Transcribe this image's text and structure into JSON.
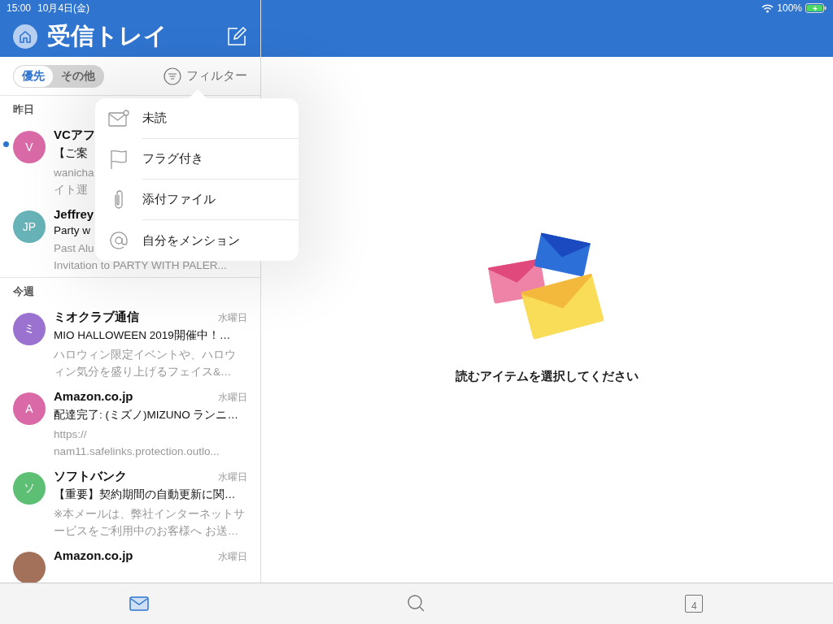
{
  "status_bar": {
    "time": "15:00",
    "date": "10月4日(金)",
    "battery": "100%"
  },
  "header": {
    "title": "受信トレイ"
  },
  "segments": [
    {
      "label": "優先",
      "selected": true
    },
    {
      "label": "その他",
      "selected": false
    }
  ],
  "filter": {
    "label": "フィルター"
  },
  "sections": [
    {
      "heading": "昨日",
      "messages": [
        {
          "initial": "V",
          "color": "#d96aa7",
          "sender": "VCアフ",
          "subject": "【ご案",
          "preview": [
            "wanicha",
            "イト運"
          ],
          "unread": true
        },
        {
          "initial": "JP",
          "color": "#67b3b8",
          "sender": "Jeffrey",
          "subject": "Party w",
          "preview": [
            "Past Alu",
            "Invitation to PARTY WITH PALER..."
          ],
          "unread": false
        }
      ]
    },
    {
      "heading": "今週",
      "messages": [
        {
          "initial": "ミ",
          "color": "#9b72d0",
          "sender": "ミオクラブ通信",
          "date": "水曜日",
          "subject": "MIO HALLOWEEN 2019開催中！…",
          "preview": "ハロウィン限定イベントや、ハロウィン気分を盛り上げるフェイス&…",
          "unread": false
        },
        {
          "initial": "A",
          "color": "#d96aa7",
          "sender": "Amazon.co.jp",
          "date": "水曜日",
          "subject": "配達完了: (ミズノ)MIZUNO ランニ…",
          "preview": "https://\nnam11.safelinks.protection.outlo...",
          "unread": false
        },
        {
          "initial": "ソ",
          "color": "#5cbf74",
          "sender": "ソフトバンク",
          "date": "水曜日",
          "subject": "【重要】契約期間の自動更新に関…",
          "preview": "※本メールは、弊社インターネットサービスをご利用中のお客様へ お送…",
          "unread": false
        },
        {
          "color": "#a3705a",
          "sender": "Amazon.co.jp",
          "date": "水曜日",
          "unread": false
        }
      ]
    }
  ],
  "filter_menu": [
    {
      "label": "未読",
      "kind": "unread"
    },
    {
      "label": "フラグ付き",
      "kind": "flag"
    },
    {
      "label": "添付ファイル",
      "kind": "attachment"
    },
    {
      "label": "自分をメンション",
      "kind": "mention"
    }
  ],
  "empty_state": {
    "message": "読むアイテムを選択してください"
  },
  "tab_bar": [
    {
      "kind": "mail",
      "selected": true
    },
    {
      "kind": "search",
      "selected": false
    },
    {
      "kind": "calendar",
      "label": "4",
      "selected": false
    }
  ]
}
